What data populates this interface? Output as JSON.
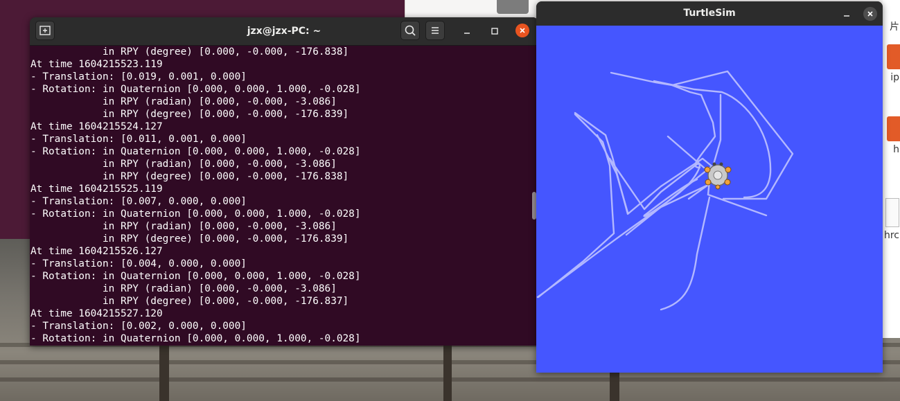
{
  "terminal": {
    "title": "jzx@jzx-PC: ~",
    "lines": [
      "            in RPY (degree) [0.000, -0.000, -176.838]",
      "At time 1604215523.119",
      "- Translation: [0.019, 0.001, 0.000]",
      "- Rotation: in Quaternion [0.000, 0.000, 1.000, -0.028]",
      "            in RPY (radian) [0.000, -0.000, -3.086]",
      "            in RPY (degree) [0.000, -0.000, -176.839]",
      "At time 1604215524.127",
      "- Translation: [0.011, 0.001, 0.000]",
      "- Rotation: in Quaternion [0.000, 0.000, 1.000, -0.028]",
      "            in RPY (radian) [0.000, -0.000, -3.086]",
      "            in RPY (degree) [0.000, -0.000, -176.838]",
      "At time 1604215525.119",
      "- Translation: [0.007, 0.000, 0.000]",
      "- Rotation: in Quaternion [0.000, 0.000, 1.000, -0.028]",
      "            in RPY (radian) [0.000, -0.000, -3.086]",
      "            in RPY (degree) [0.000, -0.000, -176.839]",
      "At time 1604215526.127",
      "- Translation: [0.004, 0.000, 0.000]",
      "- Rotation: in Quaternion [0.000, 0.000, 1.000, -0.028]",
      "            in RPY (radian) [0.000, -0.000, -3.086]",
      "            in RPY (degree) [0.000, -0.000, -176.837]",
      "At time 1604215527.120",
      "- Translation: [0.002, 0.000, 0.000]",
      "- Rotation: in Quaternion [0.000, 0.000, 1.000, -0.028]"
    ]
  },
  "turtlesim": {
    "title": "TurtleSim",
    "background_color": "#4556ff",
    "trail_color": "#b3b8ff"
  },
  "file_manager": {
    "side_fragments": [
      "片",
      "ip",
      "h",
      "hrc"
    ]
  },
  "colors": {
    "terminal_bg": "#300a24",
    "accent_close": "#e95420"
  }
}
